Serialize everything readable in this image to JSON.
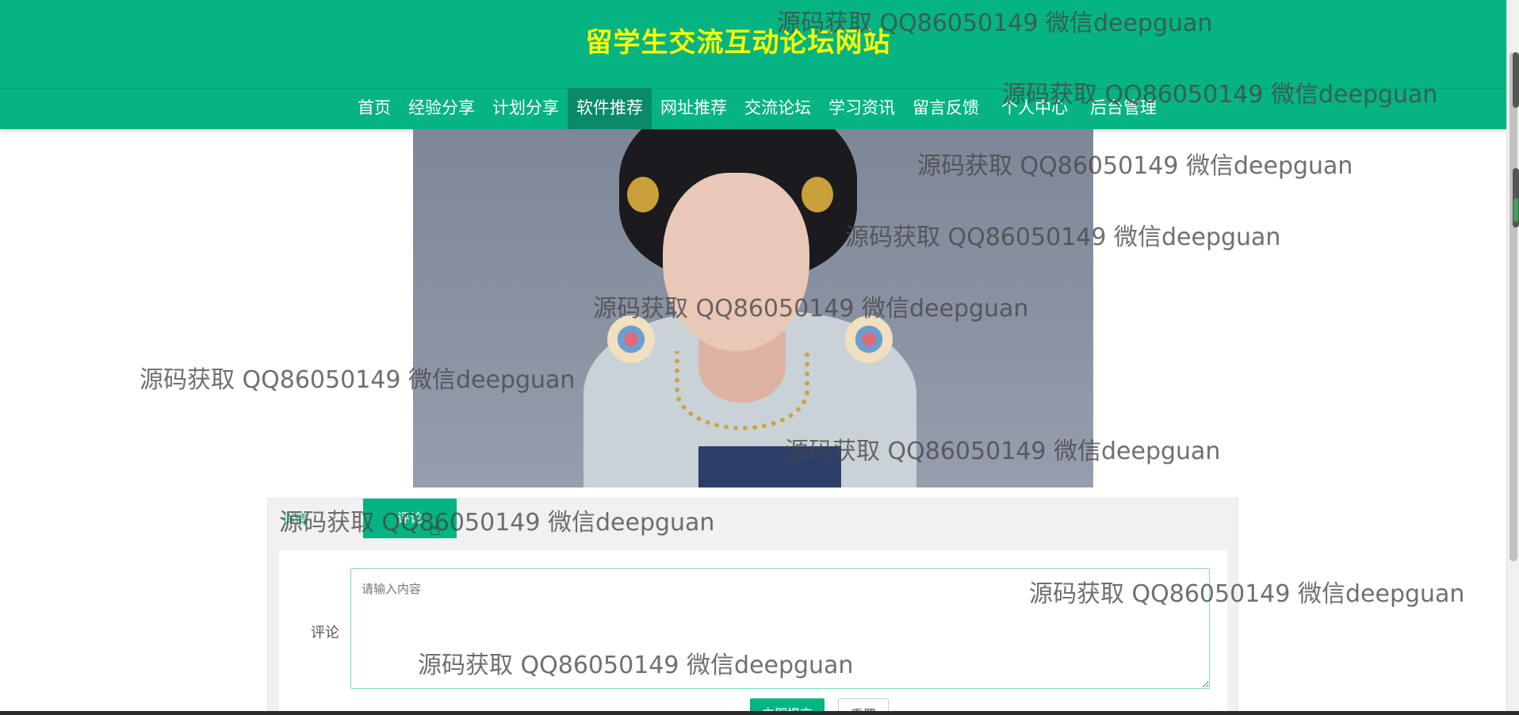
{
  "site": {
    "title": "留学生交流互动论坛网站"
  },
  "nav": {
    "items": [
      {
        "label": "首页"
      },
      {
        "label": "经验分享"
      },
      {
        "label": "计划分享"
      },
      {
        "label": "软件推荐",
        "active": true
      },
      {
        "label": "网址推荐"
      },
      {
        "label": "交流论坛"
      },
      {
        "label": "学习资讯"
      },
      {
        "label": "留言反馈"
      },
      {
        "label": "个人中心"
      },
      {
        "label": "后台管理"
      }
    ]
  },
  "comment_section": {
    "tabs": [
      {
        "label": "详情"
      },
      {
        "label": "评论",
        "active": true
      }
    ],
    "field_label": "评论",
    "textarea_placeholder": "请输入内容",
    "submit_label": "立即提交",
    "reset_label": "重置"
  },
  "watermark": {
    "text": "源码获取 QQ86050149 微信deepguan"
  },
  "colors": {
    "primary": "#05b482",
    "title": "#fbff00",
    "active_nav": "#0a8a6a"
  }
}
